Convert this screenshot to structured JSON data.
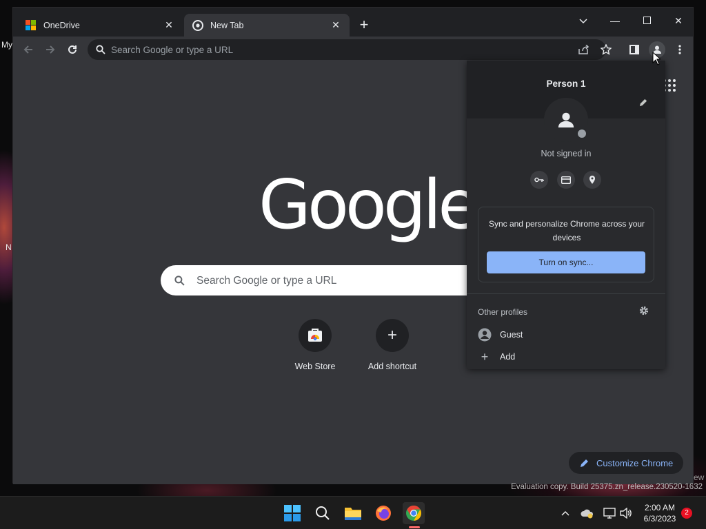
{
  "desktop": {
    "frag_my": "My",
    "frag_n": "N",
    "frag_ew": "ew"
  },
  "tabs": [
    {
      "title": "OneDrive",
      "icon": "microsoft-logo-icon",
      "active": false
    },
    {
      "title": "New Tab",
      "icon": "chrome-icon",
      "active": true
    }
  ],
  "toolbar": {
    "omnibox_placeholder": "Search Google or type a URL"
  },
  "ntp": {
    "logo": "Google",
    "search_placeholder": "Search Google or type a URL",
    "shortcuts": [
      {
        "label": "Web Store",
        "icon": "web-store-icon"
      },
      {
        "label": "Add shortcut",
        "icon": "plus-icon"
      }
    ],
    "customize_label": "Customize Chrome"
  },
  "profile_menu": {
    "name": "Person 1",
    "status": "Not signed in",
    "sync_text": "Sync and personalize Chrome across your devices",
    "sync_button": "Turn on sync...",
    "other_profiles_label": "Other profiles",
    "profiles": [
      {
        "label": "Guest",
        "icon": "guest-avatar-icon"
      },
      {
        "label": "Add",
        "icon": "plus-icon"
      }
    ]
  },
  "watermark": "Evaluation copy. Build 25375.zn_release.230520-1632",
  "taskbar": {
    "time": "2:00 AM",
    "date": "6/3/2023",
    "notification_count": "2"
  },
  "colors": {
    "accent": "#8ab4f8",
    "surface": "#35363a",
    "frame": "#202124",
    "menu": "#292a2d"
  }
}
